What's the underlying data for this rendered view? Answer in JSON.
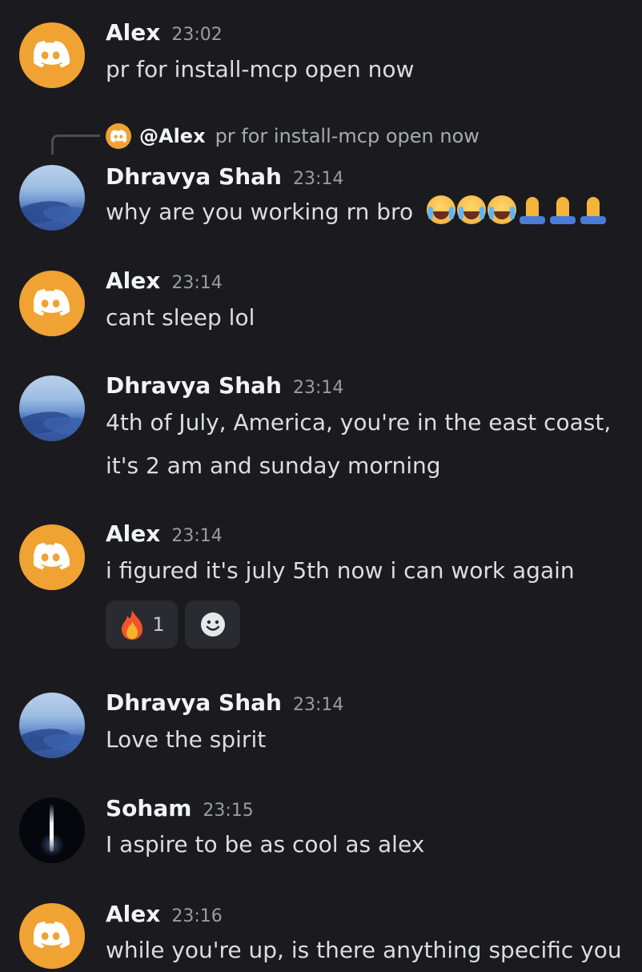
{
  "messages": [
    {
      "author": "Alex",
      "time": "23:02",
      "lines": [
        "pr for install-mcp open now"
      ]
    },
    {
      "reply": {
        "mention": "@Alex",
        "text": "pr for install-mcp open now"
      },
      "author": "Dhravya Shah",
      "time": "23:14",
      "lines": [
        "why are you working rn bro"
      ],
      "emojis": [
        "loudly-crying-face",
        "loudly-crying-face",
        "loudly-crying-face",
        "folded-hands",
        "folded-hands",
        "folded-hands"
      ]
    },
    {
      "author": "Alex",
      "time": "23:14",
      "lines": [
        "cant sleep lol"
      ]
    },
    {
      "author": "Dhravya Shah",
      "time": "23:14",
      "lines": [
        "4th of July, America, you're in the east coast,",
        "it's 2 am and sunday morning"
      ]
    },
    {
      "author": "Alex",
      "time": "23:14",
      "lines": [
        "i figured it's july 5th now i can work again"
      ],
      "reactions": [
        {
          "emoji": "fire-icon",
          "count": "1"
        },
        {
          "emoji": "add-reaction-icon",
          "count": ""
        }
      ]
    },
    {
      "author": "Dhravya Shah",
      "time": "23:14",
      "lines": [
        "Love the spirit"
      ]
    },
    {
      "author": "Soham",
      "time": "23:15",
      "lines": [
        "I aspire to be as cool as alex"
      ]
    },
    {
      "author": "Alex",
      "time": "23:16",
      "lines": [
        "while you're up, is there anything specific you"
      ]
    }
  ],
  "colors": {
    "background": "#1b1b1f",
    "discord_orange": "#f0a232",
    "reaction_bg": "#2a2b31"
  }
}
